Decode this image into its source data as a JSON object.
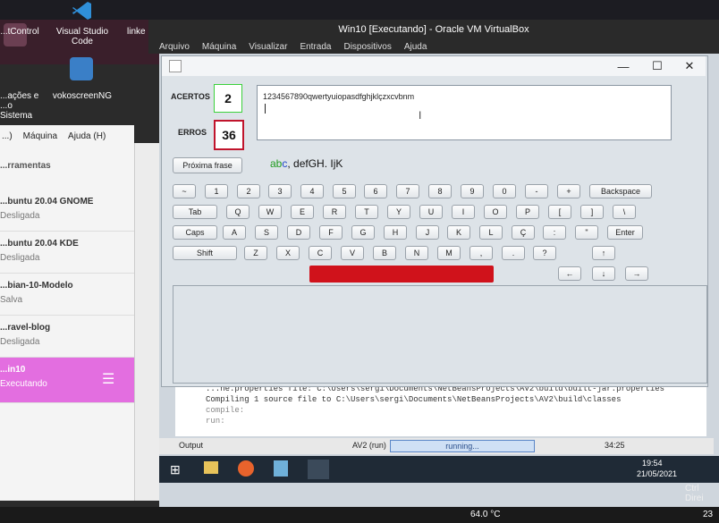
{
  "desktop": {
    "icons": [
      {
        "label": "...tControl"
      },
      {
        "label": "Visual Studio Code"
      },
      {
        "label": "linke"
      },
      {
        "label": "...ações e ...o Sistema"
      },
      {
        "label": "vokoscreenNG"
      }
    ]
  },
  "vbox": {
    "title": "Win10 [Executando] - Oracle VM VirtualBox",
    "menu": [
      "Arquivo",
      "Máquina",
      "Visualizar",
      "Entrada",
      "Dispositivos",
      "Ajuda"
    ]
  },
  "manager": {
    "menu": [
      "...)",
      "Máquina",
      "Ajuda (H)"
    ],
    "tools_label": "...rramentas",
    "vms": [
      {
        "name": "...buntu 20.04 GNOME",
        "status": "Desligada"
      },
      {
        "name": "...buntu 20.04 KDE",
        "status": "Desligada"
      },
      {
        "name": "...bian-10-Modelo",
        "status": "Salva"
      },
      {
        "name": "...ravel-blog",
        "status": "Desligada"
      },
      {
        "name": "...in10",
        "status": "Executando"
      }
    ]
  },
  "app": {
    "hits_label": "ACERTOS",
    "hits_value": "2",
    "errors_label": "ERROS",
    "errors_value": "36",
    "typed_text": "1234567890qwertyuiopasdfghjklçzxcvbnm",
    "next_button": "Próxima frase",
    "phrase": {
      "part1": "ab",
      "part2": "c",
      "part3": ", defGH. IjK"
    },
    "colors": {
      "hits_border": "#3bd13b",
      "errors_border": "#c0142c",
      "space": "#d0121b",
      "typed_ok": "#1f9b1f",
      "current": "#1f46c8"
    },
    "keys": {
      "row1": [
        "~",
        "1",
        "2",
        "3",
        "4",
        "5",
        "6",
        "7",
        "8",
        "9",
        "0",
        "-",
        "+",
        "Backspace"
      ],
      "row2": [
        "Tab",
        "Q",
        "W",
        "E",
        "R",
        "T",
        "Y",
        "U",
        "I",
        "O",
        "P",
        "[",
        "]",
        "\\"
      ],
      "row3": [
        "Caps",
        "A",
        "S",
        "D",
        "F",
        "G",
        "H",
        "J",
        "K",
        "L",
        "Ç",
        ":",
        "\"",
        "Enter"
      ],
      "row4": [
        "Shift",
        "Z",
        "X",
        "C",
        "V",
        "B",
        "N",
        "M",
        ",",
        ".",
        "?",
        "↑"
      ],
      "arrows": [
        "←",
        "↓",
        "→"
      ]
    }
  },
  "netbeans": {
    "lines": [
      "...ne.properties file: C:\\Users\\sergi\\Documents\\NetBeansProjects\\AV2\\build\\built-jar.properties",
      "Compiling 1 source file to C:\\Users\\sergi\\Documents\\NetBeansProjects\\AV2\\build\\classes",
      "compile:",
      "run:"
    ],
    "output_tab": "Output",
    "run_label": "AV2 (run)",
    "running": "running...",
    "position": "34:25"
  },
  "guest_taskbar": {
    "time": "19:54",
    "date": "21/05/2021"
  },
  "host_status": {
    "right_ctrl": "Ctrl Direi",
    "temp": "64.0 °C",
    "clock": "23"
  }
}
